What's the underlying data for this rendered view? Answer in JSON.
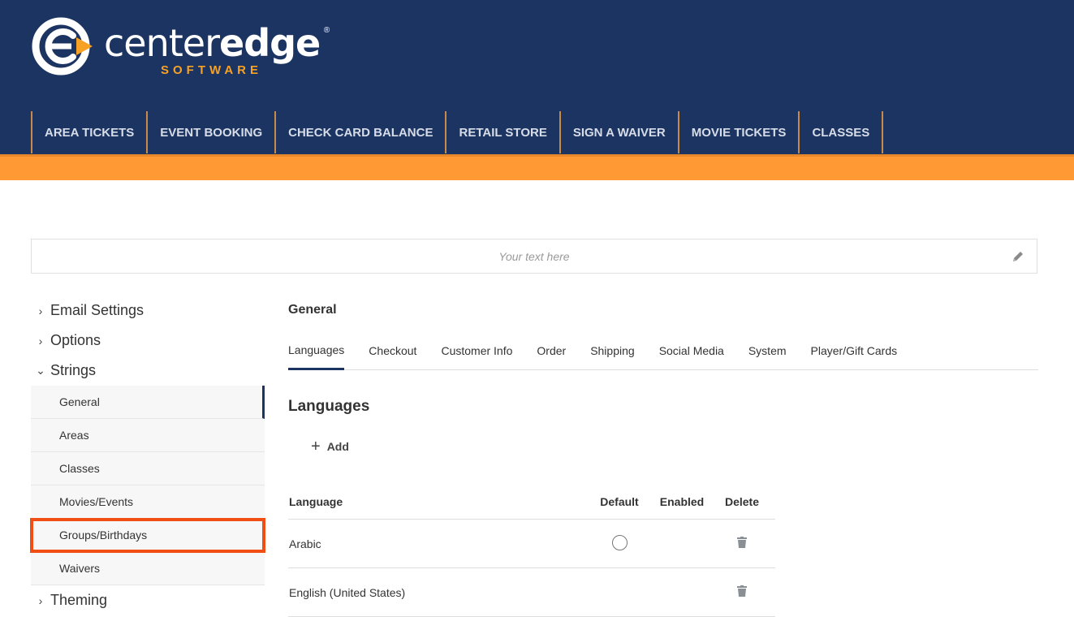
{
  "logo": {
    "word_light": "center",
    "word_bold": "edge",
    "sub": "SOFTWARE",
    "reg": "®"
  },
  "nav": [
    "AREA TICKETS",
    "EVENT BOOKING",
    "CHECK CARD BALANCE",
    "RETAIL STORE",
    "SIGN A WAIVER",
    "MOVIE TICKETS",
    "CLASSES"
  ],
  "banner": {
    "placeholder": "Your text here"
  },
  "sidebar": {
    "groups": [
      "Email Settings",
      "Options",
      "Strings",
      "Theming"
    ],
    "strings_items": [
      "General",
      "Areas",
      "Classes",
      "Movies/Events",
      "Groups/Birthdays",
      "Waivers"
    ]
  },
  "main": {
    "section": "General",
    "tabs": [
      "Languages",
      "Checkout",
      "Customer Info",
      "Order",
      "Shipping",
      "Social Media",
      "System",
      "Player/Gift Cards"
    ],
    "title": "Languages",
    "add_label": "Add"
  },
  "table": {
    "headers": {
      "language": "Language",
      "default": "Default",
      "enabled": "Enabled",
      "delete": "Delete"
    },
    "rows": [
      {
        "language": "Arabic"
      },
      {
        "language": "English (United States)"
      }
    ]
  },
  "colors": {
    "header": "#1c3461",
    "accent": "#ff9933",
    "highlight": "#f04e14"
  }
}
